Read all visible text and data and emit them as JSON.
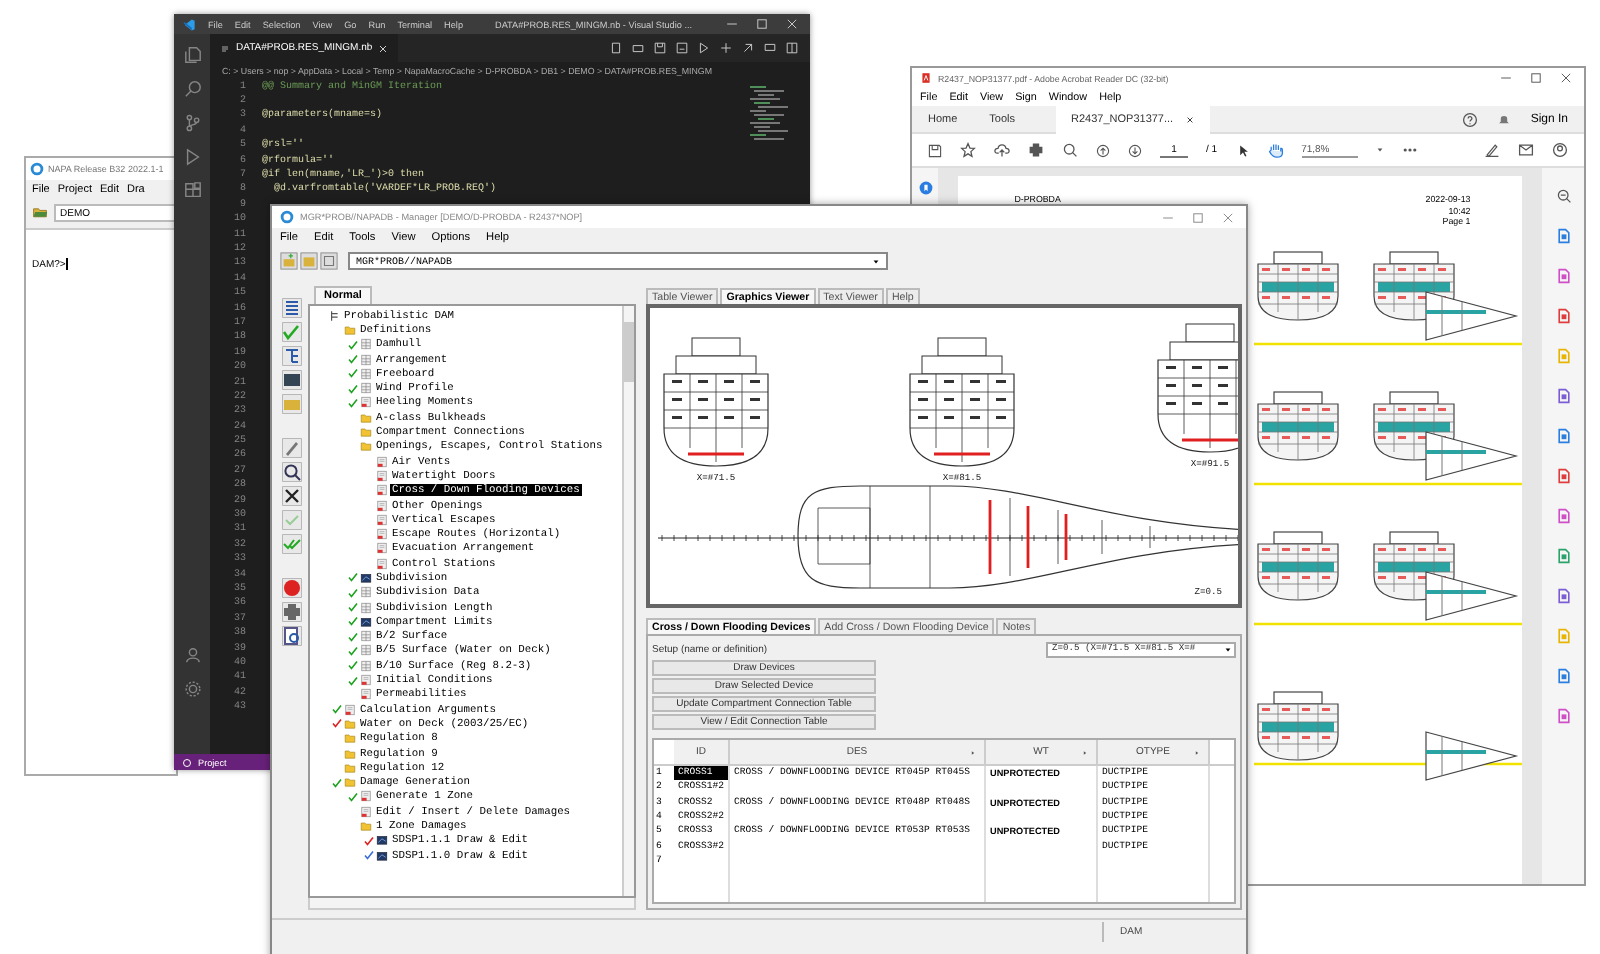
{
  "napa": {
    "title": "NAPA Release B32 2022.1-1",
    "menu": [
      "File",
      "Project",
      "Edit",
      "Dra"
    ],
    "command": "DEMO",
    "prompt": "DAM?>"
  },
  "vscode": {
    "menu": [
      "File",
      "Edit",
      "Selection",
      "View",
      "Go",
      "Run",
      "Terminal",
      "Help"
    ],
    "title": "DATA#PROB.RES_MINGM.nb - Visual Studio ...",
    "tab": "DATA#PROB.RES_MINGM.nb",
    "breadcrumb": "C: > Users > nop > AppData > Local > Temp > NapaMacroCache > D-PROBDA > DB1 > DEMO > DATA#PROB.RES_MINGM",
    "lines": [
      {
        "number": "1",
        "code": "@@ Summary and MinGM Iteration",
        "kind": "comment"
      },
      {
        "number": "2"
      },
      {
        "number": "3",
        "code": "@parameters(mname=s)",
        "kind": "code"
      },
      {
        "number": "4"
      },
      {
        "number": "5",
        "code": "@rsl=''",
        "kind": "code"
      },
      {
        "number": "6",
        "code": "@rformula=''",
        "kind": "code"
      },
      {
        "number": "7",
        "code": "@if len(mname,'LR_')>0 then",
        "kind": "code"
      },
      {
        "number": "8",
        "code": "  @d.varfromtable('VARDEF*LR_PROB.REQ')",
        "kind": "code"
      },
      {
        "number": "9"
      },
      {
        "number": "10"
      },
      {
        "number": "11"
      },
      {
        "number": "12"
      },
      {
        "number": "13"
      },
      {
        "number": "14"
      },
      {
        "number": "15"
      },
      {
        "number": "16"
      },
      {
        "number": "17"
      },
      {
        "number": "18"
      },
      {
        "number": "19"
      },
      {
        "number": "20"
      },
      {
        "number": "21"
      },
      {
        "number": "22"
      },
      {
        "number": "23"
      },
      {
        "number": "24"
      },
      {
        "number": "25"
      },
      {
        "number": "26"
      },
      {
        "number": "27"
      },
      {
        "number": "28"
      },
      {
        "number": "29"
      },
      {
        "number": "30"
      },
      {
        "number": "31"
      },
      {
        "number": "32"
      },
      {
        "number": "33"
      },
      {
        "number": "34"
      },
      {
        "number": "35"
      },
      {
        "number": "36"
      },
      {
        "number": "37"
      },
      {
        "number": "38"
      },
      {
        "number": "39"
      },
      {
        "number": "40"
      },
      {
        "number": "41"
      },
      {
        "number": "42"
      },
      {
        "number": "43"
      }
    ],
    "status": "Project"
  },
  "acrobat": {
    "title": "R2437_NOP31377.pdf - Adobe Acrobat Reader DC (32-bit)",
    "menu": [
      "File",
      "Edit",
      "View",
      "Sign",
      "Window",
      "Help"
    ],
    "tabs": [
      {
        "label": "Home",
        "selected": false
      },
      {
        "label": "Tools",
        "selected": false
      },
      {
        "label": "R2437_NOP31377...",
        "selected": true
      }
    ],
    "sign_in": "Sign In",
    "page": "1",
    "page_total": "/ 1",
    "zoom": "71,8%",
    "document": {
      "project": "D-PROBDA",
      "date": "2022-09-13",
      "time": "10:42",
      "page_label": "Page 1"
    }
  },
  "manager": {
    "title": "MGR*PROB//NAPADB - Manager [DEMO/D-PROBDA - R2437*NOP]",
    "menu": [
      "File",
      "Edit",
      "Tools",
      "View",
      "Options",
      "Help"
    ],
    "combo": "MGR*PROB//NAPADB",
    "tree_tab": "Normal",
    "tree": [
      {
        "label": "Probabilistic DAM",
        "kind": "root",
        "selected": false,
        "children": [
          {
            "label": "Definitions",
            "kind": "folder",
            "selected": false,
            "children": [
              {
                "label": "Damhull",
                "kind": "grid",
                "color": "#1fa21f",
                "selected": false
              },
              {
                "label": "Arrangement",
                "kind": "grid",
                "color": "#1fa21f",
                "selected": false
              },
              {
                "label": "Freeboard",
                "kind": "grid",
                "color": "#1fa21f",
                "selected": false
              },
              {
                "label": "Wind Profile",
                "kind": "grid",
                "color": "#1fa21f",
                "selected": false
              },
              {
                "label": "Heeling Moments",
                "kind": "doc",
                "color": "#1fa21f",
                "selected": false
              },
              {
                "label": "A-class Bulkheads",
                "kind": "folder",
                "selected": false
              },
              {
                "label": "Compartment Connections",
                "kind": "folder",
                "selected": false
              },
              {
                "label": "Openings, Escapes, Control Stations",
                "kind": "folder",
                "selected": false,
                "children": [
                  {
                    "label": "Air Vents",
                    "kind": "doc",
                    "selected": false
                  },
                  {
                    "label": "Watertight Doors",
                    "kind": "doc",
                    "selected": false
                  },
                  {
                    "label": "Cross / Down Flooding Devices",
                    "kind": "doc",
                    "selected": true
                  },
                  {
                    "label": "Other Openings",
                    "kind": "doc",
                    "selected": false
                  },
                  {
                    "label": "Vertical Escapes",
                    "kind": "doc",
                    "selected": false
                  },
                  {
                    "label": "Escape Routes (Horizontal)",
                    "kind": "doc",
                    "selected": false
                  },
                  {
                    "label": "Evacuation Arrangement",
                    "kind": "doc",
                    "selected": false
                  },
                  {
                    "label": "Control Stations",
                    "kind": "doc",
                    "selected": false
                  }
                ]
              },
              {
                "label": "Subdivision",
                "kind": "damage",
                "color": "#1fa21f",
                "selected": false
              },
              {
                "label": "Subdivision Data",
                "kind": "grid",
                "color": "#1fa21f",
                "selected": false
              },
              {
                "label": "Subdivision Length",
                "kind": "grid",
                "color": "#1fa21f",
                "selected": false
              },
              {
                "label": "Compartment Limits",
                "kind": "damage",
                "color": "#1fa21f",
                "selected": false
              },
              {
                "label": "B/2 Surface",
                "kind": "grid",
                "color": "#1fa21f",
                "selected": false
              },
              {
                "label": "B/5 Surface (Water on Deck)",
                "kind": "grid",
                "color": "#1fa21f",
                "selected": false
              },
              {
                "label": "B/10 Surface (Reg 8.2-3)",
                "kind": "grid",
                "color": "#1fa21f",
                "selected": false
              },
              {
                "label": "Initial Conditions",
                "kind": "doc",
                "color": "#1fa21f",
                "selected": false
              },
              {
                "label": "Permeabilities",
                "kind": "doc",
                "selected": false
              }
            ]
          },
          {
            "label": "Calculation Arguments",
            "kind": "doc",
            "color": "#1fa21f",
            "selected": false
          },
          {
            "label": "Water on Deck (2003/25/EC)",
            "kind": "folder",
            "color": "#dd2222",
            "selected": false
          },
          {
            "label": "Regulation 8",
            "kind": "folder",
            "selected": false
          },
          {
            "label": "Regulation 9",
            "kind": "folder",
            "selected": false
          },
          {
            "label": "Regulation 12",
            "kind": "folder",
            "selected": false
          },
          {
            "label": "Damage Generation",
            "kind": "folder",
            "color": "#1fa21f",
            "selected": false,
            "children": [
              {
                "label": "Generate 1 Zone",
                "kind": "doc",
                "color": "#1fa21f",
                "selected": false
              },
              {
                "label": "Edit / Insert / Delete Damages",
                "kind": "doc",
                "selected": false
              },
              {
                "label": "1 Zone Damages",
                "kind": "folder",
                "selected": false,
                "children": [
                  {
                    "label": "SDSP1.1.1 Draw & Edit",
                    "kind": "damage",
                    "color": "#dd2222",
                    "selected": false
                  },
                  {
                    "label": "SDSP1.1.0 Draw & Edit",
                    "kind": "damage",
                    "color": "#3a6fd8",
                    "selected": false
                  }
                ]
              }
            ]
          }
        ]
      }
    ],
    "viewer_tabs": [
      {
        "label": "Table Viewer",
        "selected": false
      },
      {
        "label": "Graphics Viewer",
        "selected": true
      },
      {
        "label": "Text Viewer",
        "selected": false
      },
      {
        "label": "Help",
        "selected": false
      }
    ],
    "graphics": {
      "captions": [
        "X=#71.5",
        "X=#81.5",
        "X=#91.5"
      ],
      "view_label": "Z=0.5"
    },
    "lower_tabs": [
      {
        "label": "Cross / Down Flooding Devices",
        "selected": true
      },
      {
        "label": "Add Cross / Down Flooding Device",
        "selected": false
      },
      {
        "label": "Notes",
        "selected": false
      }
    ],
    "setup_label": "Setup (name or definition)",
    "setup_value": "Z=0.5 (X=#71.5 X=#81.5 X=#",
    "buttons": [
      "Draw Devices",
      "Draw Selected Device",
      "Update Compartment Connection Table",
      "View / Edit Connection Table"
    ],
    "table": {
      "columns": [
        "ID",
        "DES",
        "WT",
        "OTYPE"
      ],
      "rows": [
        {
          "number": "1",
          "id": "CROSS1",
          "des": "CROSS / DOWNFLOODING DEVICE RT045P RT045S",
          "wt": "UNPROTECTED",
          "otype": "DUCTPIPE",
          "selected": true
        },
        {
          "number": "2",
          "id": "CROSS1#2",
          "otype": "DUCTPIPE",
          "selected": false
        },
        {
          "number": "3",
          "id": "CROSS2",
          "des": "CROSS / DOWNFLOODING DEVICE RT048P RT048S",
          "wt": "UNPROTECTED",
          "otype": "DUCTPIPE",
          "selected": false
        },
        {
          "number": "4",
          "id": "CROSS2#2",
          "otype": "DUCTPIPE",
          "selected": false
        },
        {
          "number": "5",
          "id": "CROSS3",
          "des": "CROSS / DOWNFLOODING DEVICE RT053P RT053S",
          "wt": "UNPROTECTED",
          "otype": "DUCTPIPE",
          "selected": false
        },
        {
          "number": "6",
          "id": "CROSS3#2",
          "otype": "DUCTPIPE",
          "selected": false
        },
        {
          "number": "7",
          "selected": false
        }
      ]
    },
    "status": "DAM"
  }
}
